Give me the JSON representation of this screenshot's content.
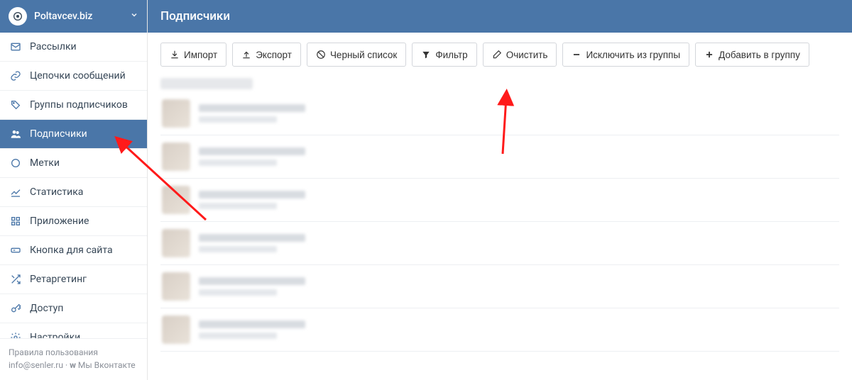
{
  "brand": {
    "name": "Poltavcev.biz"
  },
  "sidebar": {
    "items": [
      {
        "icon": "mail-icon",
        "label": "Рассылки"
      },
      {
        "icon": "link-icon",
        "label": "Цепочки сообщений"
      },
      {
        "icon": "tags-icon",
        "label": "Группы подписчиков"
      },
      {
        "icon": "users-icon",
        "label": "Подписчики",
        "active": true
      },
      {
        "icon": "circle-icon",
        "label": "Метки"
      },
      {
        "icon": "chart-icon",
        "label": "Статистика"
      },
      {
        "icon": "grid-icon",
        "label": "Приложение"
      },
      {
        "icon": "button-icon",
        "label": "Кнопка для сайта"
      },
      {
        "icon": "shuffle-icon",
        "label": "Ретаргетинг"
      },
      {
        "icon": "key-icon",
        "label": "Доступ"
      },
      {
        "icon": "gear-icon",
        "label": "Настройки"
      }
    ]
  },
  "header": {
    "title": "Подписчики"
  },
  "toolbar": {
    "import": "Импорт",
    "export": "Экспорт",
    "blacklist": "Черный список",
    "filter": "Фильтр",
    "clear": "Очистить",
    "exclude": "Исключить из группы",
    "add": "Добавить в группу"
  },
  "footer": {
    "rules": "Правила пользования",
    "email": "info@senler.ru",
    "vk_prefix": "Мы Вконтакте"
  },
  "list": {
    "rows": 6
  }
}
